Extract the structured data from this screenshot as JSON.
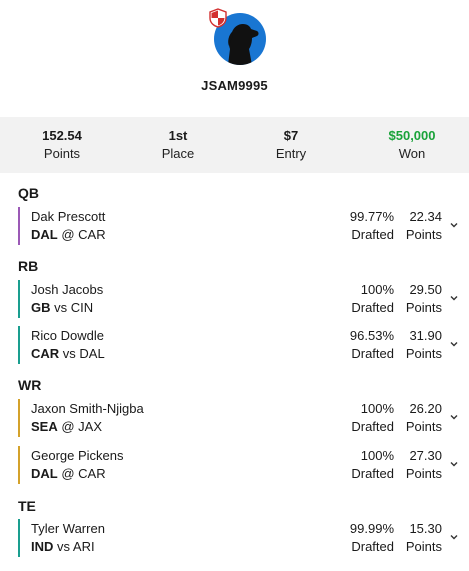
{
  "profile": {
    "username": "JSAM9995"
  },
  "stats": [
    {
      "value": "152.54",
      "label": "Points"
    },
    {
      "value": "1st",
      "label": "Place"
    },
    {
      "value": "$7",
      "label": "Entry"
    },
    {
      "value": "$50,000",
      "label": "Won"
    }
  ],
  "colors": {
    "won": "#1aa33a",
    "qb": "#9b59b6",
    "rb": "#1a9e8f",
    "wr": "#d4a22b",
    "te": "#1a9e8f",
    "avatar": "#1976d2"
  },
  "sections": [
    {
      "title": "QB"
    },
    {
      "title": "RB"
    },
    {
      "title": "WR"
    },
    {
      "title": "TE"
    }
  ],
  "players": [
    {
      "name": "Dak Prescott",
      "team": "DAL",
      "matchup": "@ CAR",
      "pct": "99.77%",
      "pct_label": "Drafted",
      "points": "22.34",
      "points_label": "Points"
    },
    {
      "name": "Josh Jacobs",
      "team": "GB",
      "matchup": "vs CIN",
      "pct": "100%",
      "pct_label": "Drafted",
      "points": "29.50",
      "points_label": "Points"
    },
    {
      "name": "Rico Dowdle",
      "team": "CAR",
      "matchup": "vs DAL",
      "pct": "96.53%",
      "pct_label": "Drafted",
      "points": "31.90",
      "points_label": "Points"
    },
    {
      "name": "Jaxon Smith-Njigba",
      "team": "SEA",
      "matchup": "@ JAX",
      "pct": "100%",
      "pct_label": "Drafted",
      "points": "26.20",
      "points_label": "Points"
    },
    {
      "name": "George Pickens",
      "team": "DAL",
      "matchup": "@ CAR",
      "pct": "100%",
      "pct_label": "Drafted",
      "points": "27.30",
      "points_label": "Points"
    },
    {
      "name": "Tyler Warren",
      "team": "IND",
      "matchup": "vs ARI",
      "pct": "99.99%",
      "pct_label": "Drafted",
      "points": "15.30",
      "points_label": "Points"
    }
  ]
}
